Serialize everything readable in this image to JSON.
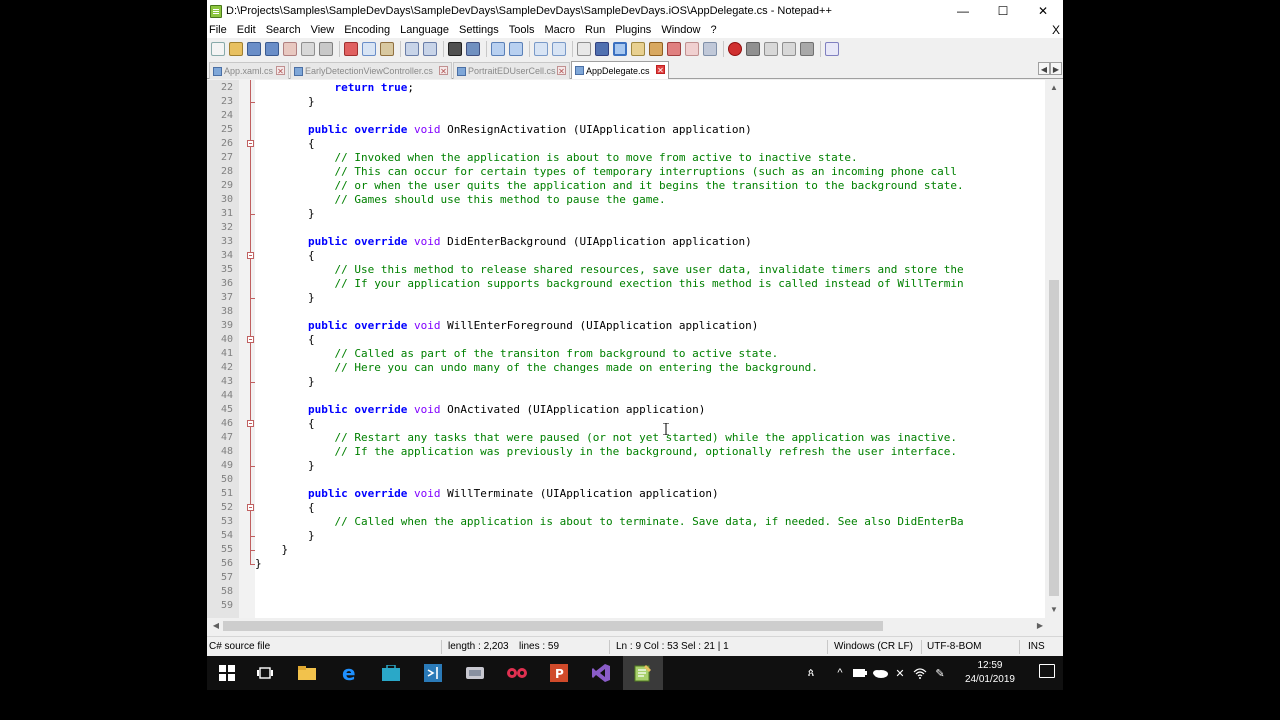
{
  "window": {
    "title": "D:\\Projects\\Samples\\SampleDevDays\\SampleDevDays\\SampleDevDays\\SampleDevDays.iOS\\AppDelegate.cs - Notepad++",
    "minimize": "—",
    "maximize": "☐",
    "close": "✕"
  },
  "menu": {
    "items": [
      "File",
      "Edit",
      "Search",
      "View",
      "Encoding",
      "Language",
      "Settings",
      "Tools",
      "Macro",
      "Run",
      "Plugins",
      "Window",
      "?"
    ],
    "close": "X"
  },
  "tabs": [
    {
      "label": "App.xaml.cs",
      "active": false
    },
    {
      "label": "EarlyDetectionViewController.cs",
      "active": false
    },
    {
      "label": "PortraitEDUserCell.cs",
      "active": false
    },
    {
      "label": "AppDelegate.cs",
      "active": true
    }
  ],
  "tab_close": "✕",
  "editor": {
    "lines": [
      {
        "n": "22",
        "segs": [
          {
            "c": "tx",
            "t": "            "
          },
          {
            "c": "kw",
            "t": "return"
          },
          {
            "c": "tx",
            "t": " "
          },
          {
            "c": "kw",
            "t": "true"
          },
          {
            "c": "tx",
            "t": ";"
          }
        ]
      },
      {
        "n": "23",
        "segs": [
          {
            "c": "tx",
            "t": "        }"
          }
        ]
      },
      {
        "n": "24",
        "segs": []
      },
      {
        "n": "25",
        "segs": [
          {
            "c": "tx",
            "t": "        "
          },
          {
            "c": "kw",
            "t": "public"
          },
          {
            "c": "tx",
            "t": " "
          },
          {
            "c": "kw",
            "t": "override"
          },
          {
            "c": "tx",
            "t": " "
          },
          {
            "c": "kw2",
            "t": "void"
          },
          {
            "c": "tx",
            "t": " OnResignActivation (UIApplication application)"
          }
        ]
      },
      {
        "n": "26",
        "segs": [
          {
            "c": "tx",
            "t": "        {"
          }
        ]
      },
      {
        "n": "27",
        "segs": [
          {
            "c": "tx",
            "t": "            "
          },
          {
            "c": "cm",
            "t": "// Invoked when the application is about to move from active to inactive state."
          }
        ]
      },
      {
        "n": "28",
        "segs": [
          {
            "c": "tx",
            "t": "            "
          },
          {
            "c": "cm",
            "t": "// This can occur for certain types of temporary interruptions (such as an incoming phone call"
          }
        ]
      },
      {
        "n": "29",
        "segs": [
          {
            "c": "tx",
            "t": "            "
          },
          {
            "c": "cm",
            "t": "// or when the user quits the application and it begins the transition to the background state."
          }
        ]
      },
      {
        "n": "30",
        "segs": [
          {
            "c": "tx",
            "t": "            "
          },
          {
            "c": "cm",
            "t": "// Games should use this method to pause the game."
          }
        ]
      },
      {
        "n": "31",
        "segs": [
          {
            "c": "tx",
            "t": "        }"
          }
        ]
      },
      {
        "n": "32",
        "segs": []
      },
      {
        "n": "33",
        "segs": [
          {
            "c": "tx",
            "t": "        "
          },
          {
            "c": "kw",
            "t": "public"
          },
          {
            "c": "tx",
            "t": " "
          },
          {
            "c": "kw",
            "t": "override"
          },
          {
            "c": "tx",
            "t": " "
          },
          {
            "c": "kw2",
            "t": "void"
          },
          {
            "c": "tx",
            "t": " DidEnterBackground (UIApplication application)"
          }
        ]
      },
      {
        "n": "34",
        "segs": [
          {
            "c": "tx",
            "t": "        {"
          }
        ]
      },
      {
        "n": "35",
        "segs": [
          {
            "c": "tx",
            "t": "            "
          },
          {
            "c": "cm",
            "t": "// Use this method to release shared resources, save user data, invalidate timers and store the"
          }
        ]
      },
      {
        "n": "36",
        "segs": [
          {
            "c": "tx",
            "t": "            "
          },
          {
            "c": "cm",
            "t": "// If your application supports background exection this method is called instead of WillTermin"
          }
        ]
      },
      {
        "n": "37",
        "segs": [
          {
            "c": "tx",
            "t": "        }"
          }
        ]
      },
      {
        "n": "38",
        "segs": []
      },
      {
        "n": "39",
        "segs": [
          {
            "c": "tx",
            "t": "        "
          },
          {
            "c": "kw",
            "t": "public"
          },
          {
            "c": "tx",
            "t": " "
          },
          {
            "c": "kw",
            "t": "override"
          },
          {
            "c": "tx",
            "t": " "
          },
          {
            "c": "kw2",
            "t": "void"
          },
          {
            "c": "tx",
            "t": " WillEnterForeground (UIApplication application)"
          }
        ]
      },
      {
        "n": "40",
        "segs": [
          {
            "c": "tx",
            "t": "        {"
          }
        ]
      },
      {
        "n": "41",
        "segs": [
          {
            "c": "tx",
            "t": "            "
          },
          {
            "c": "cm",
            "t": "// Called as part of the transiton from background to active state."
          }
        ]
      },
      {
        "n": "42",
        "segs": [
          {
            "c": "tx",
            "t": "            "
          },
          {
            "c": "cm",
            "t": "// Here you can undo many of the changes made on entering the background."
          }
        ]
      },
      {
        "n": "43",
        "segs": [
          {
            "c": "tx",
            "t": "        }"
          }
        ]
      },
      {
        "n": "44",
        "segs": []
      },
      {
        "n": "45",
        "segs": [
          {
            "c": "tx",
            "t": "        "
          },
          {
            "c": "kw",
            "t": "public"
          },
          {
            "c": "tx",
            "t": " "
          },
          {
            "c": "kw",
            "t": "override"
          },
          {
            "c": "tx",
            "t": " "
          },
          {
            "c": "kw2",
            "t": "void"
          },
          {
            "c": "tx",
            "t": " OnActivated (UIApplication application)"
          }
        ]
      },
      {
        "n": "46",
        "segs": [
          {
            "c": "tx",
            "t": "        {"
          }
        ]
      },
      {
        "n": "47",
        "segs": [
          {
            "c": "tx",
            "t": "            "
          },
          {
            "c": "cm",
            "t": "// Restart any tasks that were paused (or not yet started) while the application was inactive."
          }
        ]
      },
      {
        "n": "48",
        "segs": [
          {
            "c": "tx",
            "t": "            "
          },
          {
            "c": "cm",
            "t": "// If the application was previously in the background, optionally refresh the user interface."
          }
        ]
      },
      {
        "n": "49",
        "segs": [
          {
            "c": "tx",
            "t": "        }"
          }
        ]
      },
      {
        "n": "50",
        "segs": []
      },
      {
        "n": "51",
        "segs": [
          {
            "c": "tx",
            "t": "        "
          },
          {
            "c": "kw",
            "t": "public"
          },
          {
            "c": "tx",
            "t": " "
          },
          {
            "c": "kw",
            "t": "override"
          },
          {
            "c": "tx",
            "t": " "
          },
          {
            "c": "kw2",
            "t": "void"
          },
          {
            "c": "tx",
            "t": " WillTerminate (UIApplication application)"
          }
        ]
      },
      {
        "n": "52",
        "segs": [
          {
            "c": "tx",
            "t": "        {"
          }
        ]
      },
      {
        "n": "53",
        "segs": [
          {
            "c": "tx",
            "t": "            "
          },
          {
            "c": "cm",
            "t": "// Called when the application is about to terminate. Save data, if needed. See also DidEnterBa"
          }
        ]
      },
      {
        "n": "54",
        "segs": [
          {
            "c": "tx",
            "t": "        }"
          }
        ]
      },
      {
        "n": "55",
        "segs": [
          {
            "c": "tx",
            "t": "    }"
          }
        ]
      },
      {
        "n": "56",
        "segs": [
          {
            "c": "tx",
            "t": "}"
          }
        ]
      },
      {
        "n": "57",
        "segs": []
      },
      {
        "n": "58",
        "segs": []
      },
      {
        "n": "59",
        "segs": []
      }
    ]
  },
  "status": {
    "file_type": "C# source file",
    "length": "length : 2,203",
    "lines": "lines : 59",
    "position": "Ln : 9    Col : 53    Sel : 21 | 1",
    "eol": "Windows (CR LF)",
    "encoding": "UTF-8-BOM",
    "mode": "INS"
  },
  "taskbar": {
    "time": "12:59",
    "date": "24/01/2019"
  },
  "colors": {
    "keyword": "#0000ff",
    "type_keyword": "#8000ff",
    "comment": "#008000",
    "fold_marker": "#c06060"
  }
}
